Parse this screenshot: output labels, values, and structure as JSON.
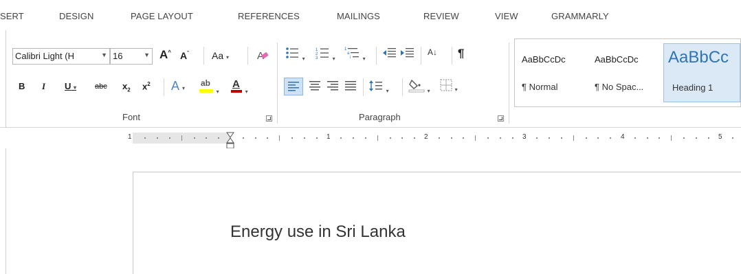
{
  "tabs": [
    "SERT",
    "DESIGN",
    "PAGE LAYOUT",
    "REFERENCES",
    "MAILINGS",
    "REVIEW",
    "VIEW",
    "GRAMMARLY"
  ],
  "font": {
    "name": "Calibri Light (H",
    "size": "16",
    "grow_label": "A",
    "shrink_label": "A",
    "case_label": "Aa",
    "bold": "B",
    "italic": "I",
    "underline": "U",
    "strike": "abc",
    "subscript": "x",
    "superscript": "x",
    "effects": "A",
    "highlight": "ab",
    "color": "A",
    "group_label": "Font"
  },
  "paragraph": {
    "sort_label": "A↓",
    "pilcrow": "¶",
    "group_label": "Paragraph"
  },
  "styles": [
    {
      "preview": "AaBbCcDc",
      "name": "¶ Normal"
    },
    {
      "preview": "AaBbCcDc",
      "name": "¶ No Spac..."
    },
    {
      "preview": "AaBbCc",
      "name": "Heading 1"
    }
  ],
  "ruler": {
    "labels": [
      "1",
      "1",
      "2",
      "3",
      "4",
      "5"
    ]
  },
  "document": {
    "text": "Energy use in Sri Lanka"
  },
  "colors": {
    "accent": "#2e74b5",
    "highlight_bar": "#ffff00",
    "font_color_bar": "#c00000"
  }
}
